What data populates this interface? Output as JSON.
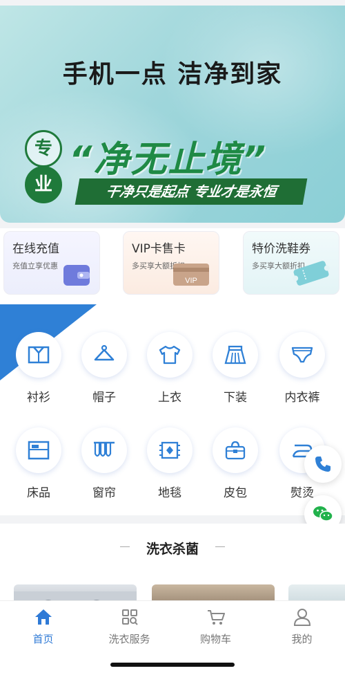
{
  "banner": {
    "title": "手机一点  洁净到家",
    "badge_top": "专",
    "badge_bottom": "业",
    "slogan": "“净无止境”",
    "tagline": "干净只是起点  专业才是永恒"
  },
  "cards": [
    {
      "title": "在线充值",
      "subtitle": "充值立享优惠",
      "icon": "wallet-icon"
    },
    {
      "title": "VIP卡售卡",
      "subtitle": "多买享大额折扣",
      "icon": "vip-card-icon"
    },
    {
      "title": "特价洗鞋券",
      "subtitle": "多买享大额折扣",
      "icon": "ticket-icon"
    }
  ],
  "categories": [
    {
      "label": "衬衫",
      "icon": "shirt-icon"
    },
    {
      "label": "帽子",
      "icon": "hat-icon"
    },
    {
      "label": "上衣",
      "icon": "top-icon"
    },
    {
      "label": "下装",
      "icon": "skirt-icon"
    },
    {
      "label": "内衣裤",
      "icon": "underwear-icon"
    },
    {
      "label": "床品",
      "icon": "bedding-icon"
    },
    {
      "label": "窗帘",
      "icon": "curtain-icon"
    },
    {
      "label": "地毯",
      "icon": "carpet-icon"
    },
    {
      "label": "皮包",
      "icon": "bag-icon"
    },
    {
      "label": "熨烫",
      "icon": "iron-icon"
    }
  ],
  "floating": {
    "phone_icon": "phone-icon",
    "wechat_icon": "wechat-icon"
  },
  "section": {
    "title": "洗衣杀菌"
  },
  "tabbar": [
    {
      "label": "首页",
      "icon": "home-icon",
      "active": true
    },
    {
      "label": "洗衣服务",
      "icon": "grid-search-icon",
      "active": false
    },
    {
      "label": "购物车",
      "icon": "cart-icon",
      "active": false
    },
    {
      "label": "我的",
      "icon": "user-icon",
      "active": false
    }
  ],
  "colors": {
    "accent": "#2f7ad6",
    "banner_green": "#1f8a45",
    "icon_blue": "#2f80d6"
  }
}
